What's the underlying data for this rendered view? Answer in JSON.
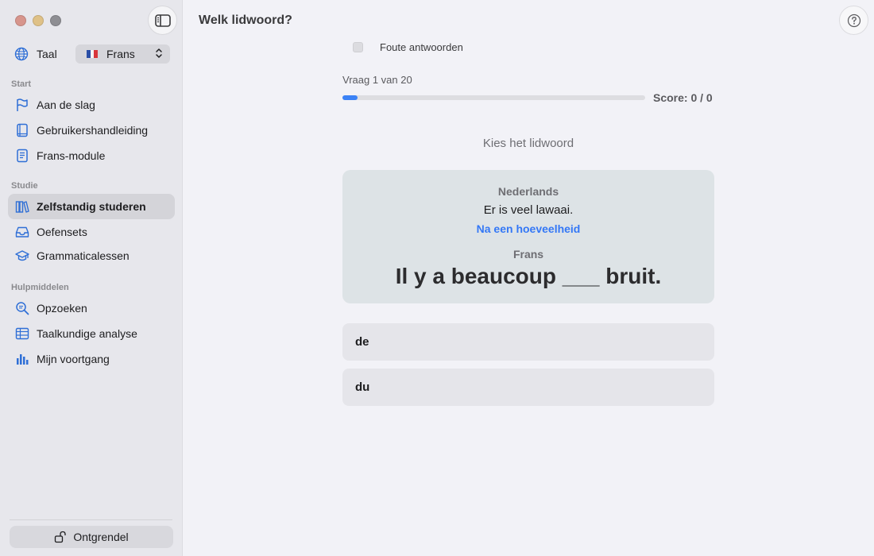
{
  "window": {
    "title": "Welk lidwoord?"
  },
  "sidebar": {
    "language_label": "Taal",
    "language_value": "Frans",
    "sections": [
      {
        "title": "Start",
        "items": [
          {
            "label": "Aan de slag",
            "icon": "flag-icon"
          },
          {
            "label": "Gebruikershandleiding",
            "icon": "book-icon"
          },
          {
            "label": "Frans-module",
            "icon": "document-icon"
          }
        ]
      },
      {
        "title": "Studie",
        "items": [
          {
            "label": "Zelfstandig studeren",
            "icon": "books-icon",
            "active": true
          },
          {
            "label": "Oefensets",
            "icon": "tray-icon"
          },
          {
            "label": "Grammaticalessen",
            "icon": "graduation-cap-icon"
          }
        ]
      },
      {
        "title": "Hulpmiddelen",
        "items": [
          {
            "label": "Opzoeken",
            "icon": "magnifier-icon"
          },
          {
            "label": "Taalkundige analyse",
            "icon": "table-icon"
          },
          {
            "label": "Mijn voortgang",
            "icon": "bar-chart-icon"
          }
        ]
      }
    ],
    "unlock_label": "Ontgrendel"
  },
  "quiz": {
    "wrong_answers_label": "Foute antwoorden",
    "wrong_answers_checked": false,
    "question_counter": "Vraag 1 van 20",
    "progress": 0.05,
    "score": "Score: 0 / 0",
    "prompt": "Kies het lidwoord",
    "card": {
      "source_language": "Nederlands",
      "source_sentence": "Er is veel lawaai.",
      "hint": "Na een hoeveelheid",
      "target_language": "Frans",
      "target_sentence": "Il y a beaucoup ___ bruit."
    },
    "answers": [
      "de",
      "du"
    ]
  },
  "colors": {
    "accent": "#3478f6",
    "progress": "#3b82f6",
    "sidebar_bg": "#e7e7ec",
    "card_bg": "#dde3e6"
  }
}
